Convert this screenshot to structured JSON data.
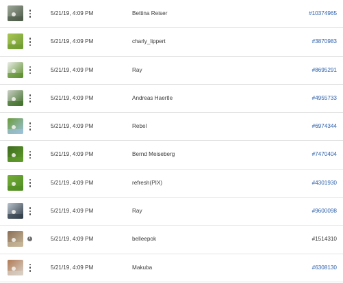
{
  "rows": [
    {
      "thumb": "golf-bag-photo",
      "thumb_colors": [
        "#4d5a48",
        "#9fa89a"
      ],
      "action": "more",
      "date": "5/21/19, 4:09 PM",
      "author": "Bettina Reiser",
      "id": "#10374965",
      "id_link": true
    },
    {
      "thumb": "golf-course-photo",
      "thumb_colors": [
        "#6f9b32",
        "#a9c655"
      ],
      "action": "more",
      "date": "5/21/19, 4:09 PM",
      "author": "charly_lippert",
      "id": "#3870983",
      "id_link": true
    },
    {
      "thumb": "golf-balls-photo",
      "thumb_colors": [
        "#5c8d2c",
        "#e8ece4"
      ],
      "action": "more",
      "date": "5/21/19, 4:09 PM",
      "author": "Ray",
      "id": "#8695291",
      "id_link": true
    },
    {
      "thumb": "golf-clubs-photo",
      "thumb_colors": [
        "#3f6f29",
        "#c9cfc2"
      ],
      "action": "more",
      "date": "5/21/19, 4:09 PM",
      "author": "Andreas Haertle",
      "id": "#4955733",
      "id_link": true
    },
    {
      "thumb": "golf-ball-sky-photo",
      "thumb_colors": [
        "#9cc1dc",
        "#6a9b3c"
      ],
      "action": "more",
      "date": "5/21/19, 4:09 PM",
      "author": "Rebel",
      "id": "#6974344",
      "id_link": true
    },
    {
      "thumb": "golf-putting-photo",
      "thumb_colors": [
        "#5f9b2b",
        "#3e6b1f"
      ],
      "action": "more",
      "date": "5/21/19, 4:09 PM",
      "author": "Bernd Meiseberg",
      "id": "#7470404",
      "id_link": true
    },
    {
      "thumb": "golf-ball-grass-photo",
      "thumb_colors": [
        "#4f8c22",
        "#76ad3a"
      ],
      "action": "more",
      "date": "5/21/19, 4:09 PM",
      "author": "refresh(PIX)",
      "id": "#4301930",
      "id_link": true
    },
    {
      "thumb": "golf-cart-photo",
      "thumb_colors": [
        "#2f3c48",
        "#b8c2cb"
      ],
      "action": "more",
      "date": "5/21/19, 4:09 PM",
      "author": "Ray",
      "id": "#9600098",
      "id_link": true
    },
    {
      "thumb": "golf-course-sand-photo",
      "thumb_colors": [
        "#c8b89a",
        "#8a6e55"
      ],
      "action": "info",
      "date": "5/21/19, 4:09 PM",
      "author": "belleepok",
      "id": "#1514310",
      "id_link": false
    },
    {
      "thumb": "dog-photo",
      "thumb_colors": [
        "#d9d2c8",
        "#b07a55"
      ],
      "action": "more",
      "date": "5/21/19, 4:09 PM",
      "author": "Makuba",
      "id": "#6308130",
      "id_link": true
    }
  ]
}
